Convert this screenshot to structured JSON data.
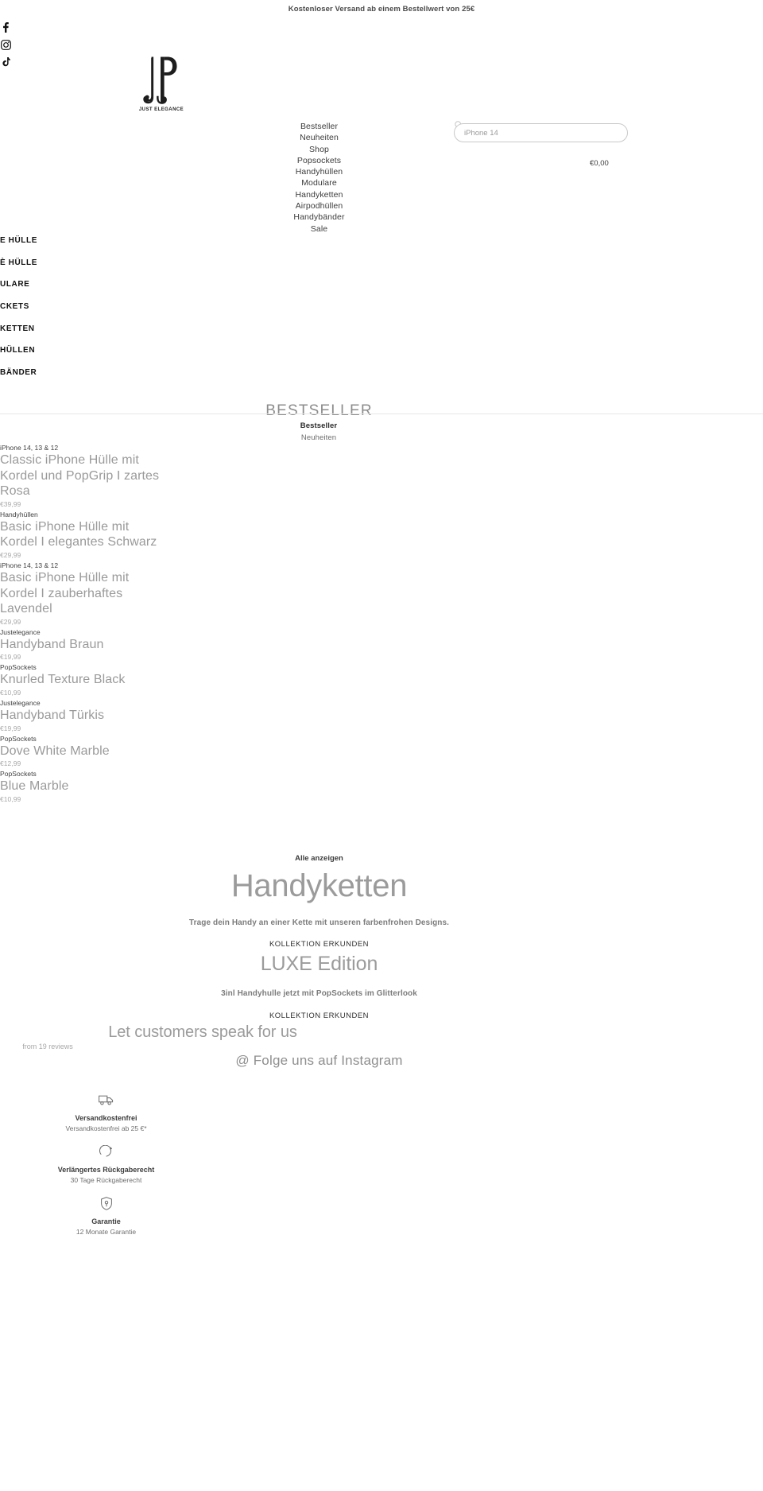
{
  "announcement": "Kostenloser Versand ab einem Bestellwert von 25€",
  "social": [
    {
      "name": "facebook-icon",
      "glyph": "f"
    },
    {
      "name": "instagram-icon",
      "glyph": "◎"
    },
    {
      "name": "tiktok-icon",
      "glyph": "♪"
    }
  ],
  "brand": {
    "wordmark": "JUST ELEGANCE"
  },
  "topnav": [
    {
      "label": "Bestseller"
    },
    {
      "label": "Neuheiten"
    },
    {
      "label": "Shop"
    },
    {
      "label": "Popsockets"
    },
    {
      "label": "Handyhüllen"
    },
    {
      "label": "Modulare"
    },
    {
      "label": "Handyketten"
    },
    {
      "label": "Airpodhüllen"
    },
    {
      "label": "Handybänder"
    },
    {
      "label": "Sale"
    }
  ],
  "search": {
    "value": "iPhone 14",
    "placeholder": "iPhone 14"
  },
  "cart": {
    "total": "€0,00"
  },
  "category_rail": [
    {
      "label": "E HÜLLE"
    },
    {
      "label": "È HÜLLE"
    },
    {
      "label": "ULARE"
    },
    {
      "label": "CKETS"
    },
    {
      "label": "KETTEN"
    },
    {
      "label": "HÜLLEN"
    },
    {
      "label": "BÄNDER"
    }
  ],
  "bestseller": {
    "title": "BESTSELLER",
    "tabs": [
      {
        "label": "Bestseller",
        "active": true
      },
      {
        "label": "Neuheiten",
        "active": false
      }
    ],
    "view_all": "Alle anzeigen",
    "products": [
      {
        "vendor": "iPhone 14, 13 & 12",
        "title": "Classic iPhone Hülle mit Kordel und PopGrip I zartes Rosa",
        "price": "€39,99"
      },
      {
        "vendor": "Handyhüllen",
        "title": "Basic iPhone Hülle mit Kordel I elegantes Schwarz",
        "price": "€29,99"
      },
      {
        "vendor": "iPhone 14, 13 & 12",
        "title": "Basic iPhone Hülle mit Kordel I zauberhaftes Lavendel",
        "price": "€29,99"
      },
      {
        "vendor": "Justelegance",
        "title": "Handyband Braun",
        "price": "€19,99"
      },
      {
        "vendor": "PopSockets",
        "title": "Knurled Texture Black",
        "price": "€10,99"
      },
      {
        "vendor": "Justelegance",
        "title": "Handyband Türkis",
        "price": "€19,99"
      },
      {
        "vendor": "PopSockets",
        "title": "Dove White Marble",
        "price": "€12,99"
      },
      {
        "vendor": "PopSockets",
        "title": "Blue Marble",
        "price": "€10,99"
      }
    ]
  },
  "promos": [
    {
      "heading": "Handyketten",
      "sub": "Trage dein Handy an einer Kette mit unseren farbenfrohen Designs.",
      "cta": "KOLLEKTION ERKUNDEN"
    },
    {
      "heading": "LUXE Edition",
      "sub": "3inl Handyhulle jetzt mit PopSockets im Glitterlook",
      "cta": "KOLLEKTION ERKUNDEN"
    }
  ],
  "reviews": {
    "title": "Let customers speak for us",
    "count": "from 19 reviews"
  },
  "instagram": {
    "label": "@ Folge uns auf Instagram"
  },
  "badges": [
    {
      "icon": "truck-icon",
      "title": "Versandkostenfrei",
      "desc": "Versandkostenfrei ab 25 €*"
    },
    {
      "icon": "return-arrow-icon",
      "title": "Verlängertes Rückgaberecht",
      "desc": "30 Tage Rückgaberecht"
    },
    {
      "icon": "shield-icon",
      "title": "Garantie",
      "desc": "12 Monate Garantie"
    }
  ],
  "colors": {
    "text": "#3c3c3c",
    "muted": "#9a9a9a",
    "rule": "#e6e6e6"
  }
}
